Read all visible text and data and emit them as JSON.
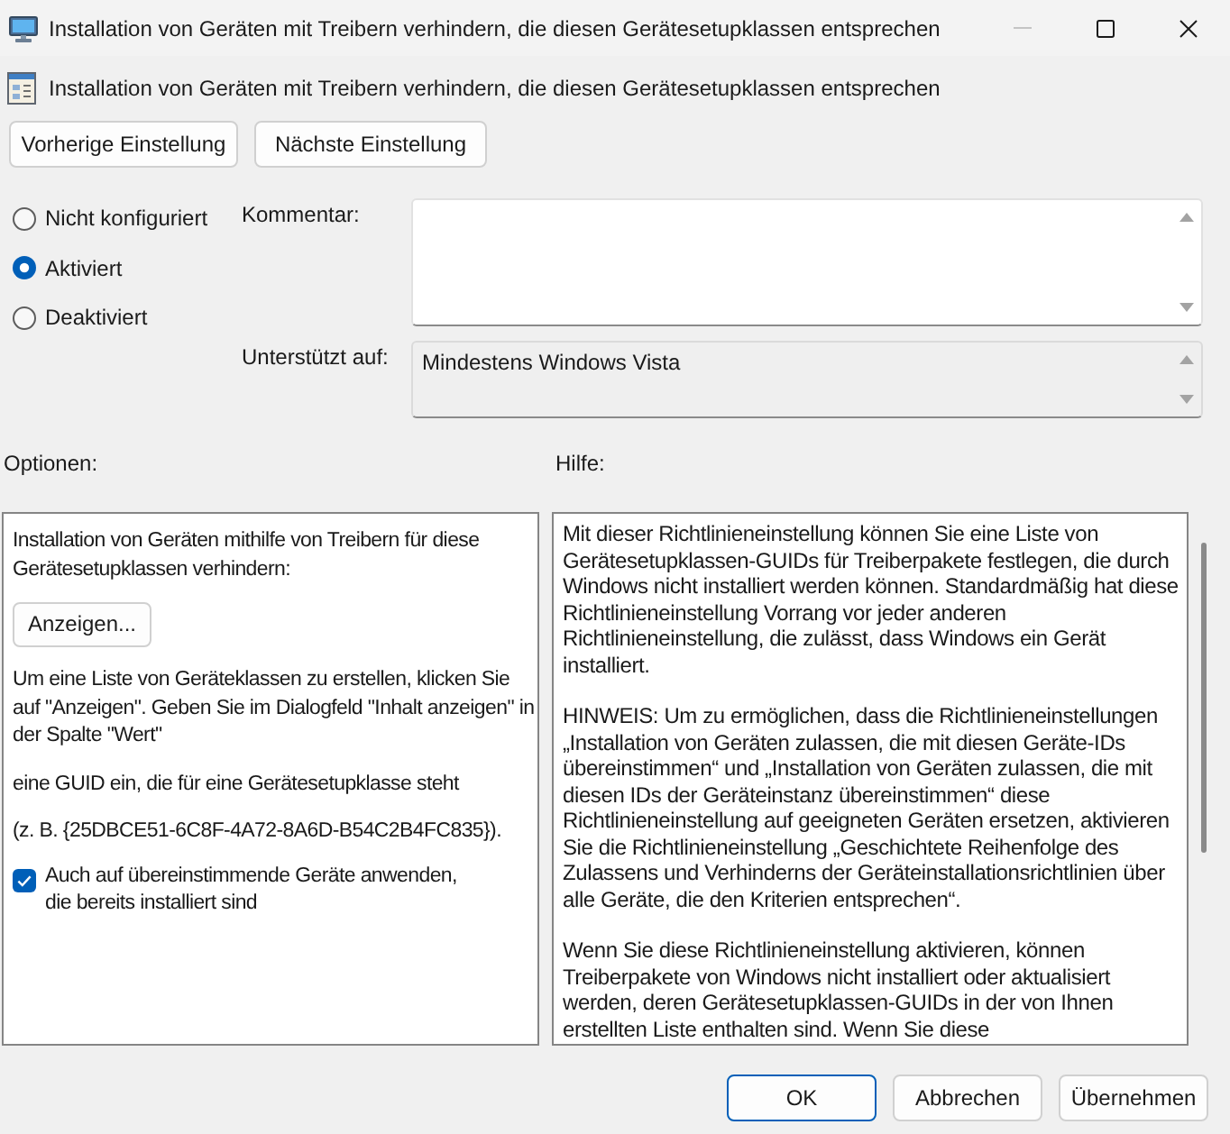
{
  "window": {
    "title": "Installation von Geräten mit Treibern verhindern, die diesen Gerätesetupklassen entsprechen",
    "controls": [
      {
        "kind": "minimize",
        "disabled": true
      },
      {
        "kind": "maximize",
        "disabled": false
      },
      {
        "kind": "close",
        "disabled": false
      }
    ]
  },
  "policy": {
    "title": "Installation von Geräten mit Treibern verhindern, die diesen Gerätesetupklassen entsprechen"
  },
  "navigation_buttons": [
    "Vorherige Einstellung",
    "Nächste Einstellung"
  ],
  "state_options": [
    {
      "label": "Nicht konfiguriert",
      "selected": false
    },
    {
      "label": "Aktiviert",
      "selected": true
    },
    {
      "label": "Deaktiviert",
      "selected": false
    }
  ],
  "comment": {
    "label": "Kommentar:"
  },
  "supported_on": {
    "label": "Unterstützt auf:",
    "value": "Mindestens Windows Vista"
  },
  "options": {
    "label": "Optionen:",
    "items": [
      {
        "kind": "text",
        "text": "Installation von Geräten mithilfe von Treibern für diese Gerätesetupklassen verhindern:"
      },
      {
        "kind": "button",
        "label": "Anzeigen..."
      },
      {
        "kind": "text",
        "text": "Um eine Liste von Geräteklassen zu erstellen, klicken Sie auf \"Anzeigen\". Geben Sie im Dialogfeld \"Inhalt anzeigen\" in der Spalte \"Wert\""
      },
      {
        "kind": "text",
        "text": "eine GUID ein, die für eine Gerätesetupklasse steht"
      },
      {
        "kind": "text",
        "text": "(z. B. {25DBCE51-6C8F-4A72-8A6D-B54C2B4FC835})."
      },
      {
        "kind": "checkbox",
        "label": "Auch auf übereinstimmende Geräte anwenden, die bereits installiert sind",
        "checked": true
      }
    ]
  },
  "help": {
    "label": "Hilfe:",
    "paragraphs": [
      "Mit dieser Richtlinieneinstellung können Sie eine Liste von Gerätesetupklassen-GUIDs für Treiberpakete festlegen, die durch Windows nicht installiert werden können. Standardmäßig hat diese Richtlinieneinstellung Vorrang vor jeder anderen Richtlinieneinstellung, die zulässt, dass Windows ein Gerät installiert.",
      "HINWEIS: Um zu ermöglichen, dass die Richtlinieneinstellungen „Installation von Geräten zulassen, die mit diesen Geräte-IDs übereinstimmen“ und „Installation von Geräten zulassen, die mit diesen IDs der Geräteinstanz übereinstimmen“ diese Richtlinieneinstellung auf geeigneten Geräten ersetzen, aktivieren Sie die Richtlinieneinstellung „Geschichtete Reihenfolge des Zulassens und Verhinderns der Geräteinstallationsrichtlinien über alle Geräte, die den Kriterien entsprechen“.",
      "Wenn Sie diese Richtlinieneinstellung aktivieren, können Treiberpakete von Windows nicht installiert oder aktualisiert werden, deren Gerätesetupklassen-GUIDs in der von Ihnen erstellten Liste enthalten sind. Wenn Sie diese"
    ]
  },
  "dialog_buttons": [
    {
      "label": "OK",
      "default": true
    },
    {
      "label": "Abbrechen",
      "default": false
    },
    {
      "label": "Übernehmen",
      "default": false
    }
  ]
}
